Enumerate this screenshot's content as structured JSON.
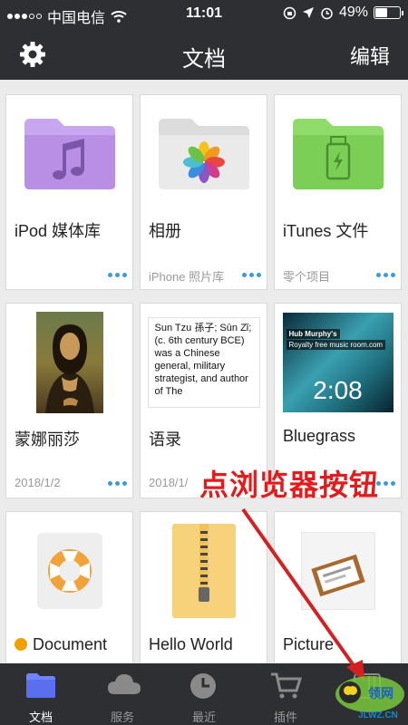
{
  "status_bar": {
    "carrier": "中国电信",
    "time": "11:01",
    "battery": "49%",
    "battery_level": 0.49
  },
  "nav": {
    "title": "文档",
    "edit": "编辑",
    "settings_icon": "gear-icon"
  },
  "items": [
    {
      "name": "iPod 媒体库",
      "sub": "",
      "thumb": "purple-folder-music-icon",
      "menu_icon": "more-dots-icon"
    },
    {
      "name": "相册",
      "sub": "iPhone 照片库",
      "thumb": "grey-folder-photos-icon",
      "menu_icon": "more-dots-icon"
    },
    {
      "name": "iTunes 文件",
      "sub": "零个项目",
      "thumb": "green-folder-usb-icon",
      "menu_icon": "more-dots-icon"
    },
    {
      "name": "蒙娜丽莎",
      "sub": "2018/1/2",
      "thumb": "mona-lisa-image",
      "menu_icon": "more-dots-icon"
    },
    {
      "name": "语录",
      "sub": "2018/1/",
      "thumb": "text-document",
      "quote": "Sun Tzu 孫子; Sūn Zǐ; (c. 6th century BCE) was a Chinese general, military strategist, and author of The",
      "menu_icon": "more-dots-icon"
    },
    {
      "name": "Bluegrass",
      "sub": "",
      "thumb": "video-thumbnail",
      "video_brand": "Hub Murphy's",
      "video_brand2": "Royalty free music room.com",
      "duration": "2:08",
      "menu_icon": "more-dots-icon"
    },
    {
      "name": "Document",
      "sub": "",
      "thumb": "lifebuoy-icon",
      "menu_icon": ""
    },
    {
      "name": "Hello World",
      "sub": "",
      "thumb": "zip-archive-icon",
      "menu_icon": ""
    },
    {
      "name": "Picture",
      "sub": "",
      "thumb": "picture-frame-icon",
      "menu_icon": ""
    }
  ],
  "tabs": [
    {
      "label": "文档",
      "icon": "folder-icon",
      "active": true
    },
    {
      "label": "服务",
      "icon": "cloud-icon",
      "active": false
    },
    {
      "label": "最近",
      "icon": "clock-icon",
      "active": false
    },
    {
      "label": "插件",
      "icon": "cart-icon",
      "active": false
    },
    {
      "label": "",
      "icon": "browser-icon",
      "active": false
    }
  ],
  "annotation": {
    "text": "点浏览器按钮"
  },
  "watermark": {
    "text": "JLWZ.CN"
  },
  "colors": {
    "bar": "#2e2f33",
    "accent": "#3a9bd9",
    "annotation": "#e51b1b"
  }
}
